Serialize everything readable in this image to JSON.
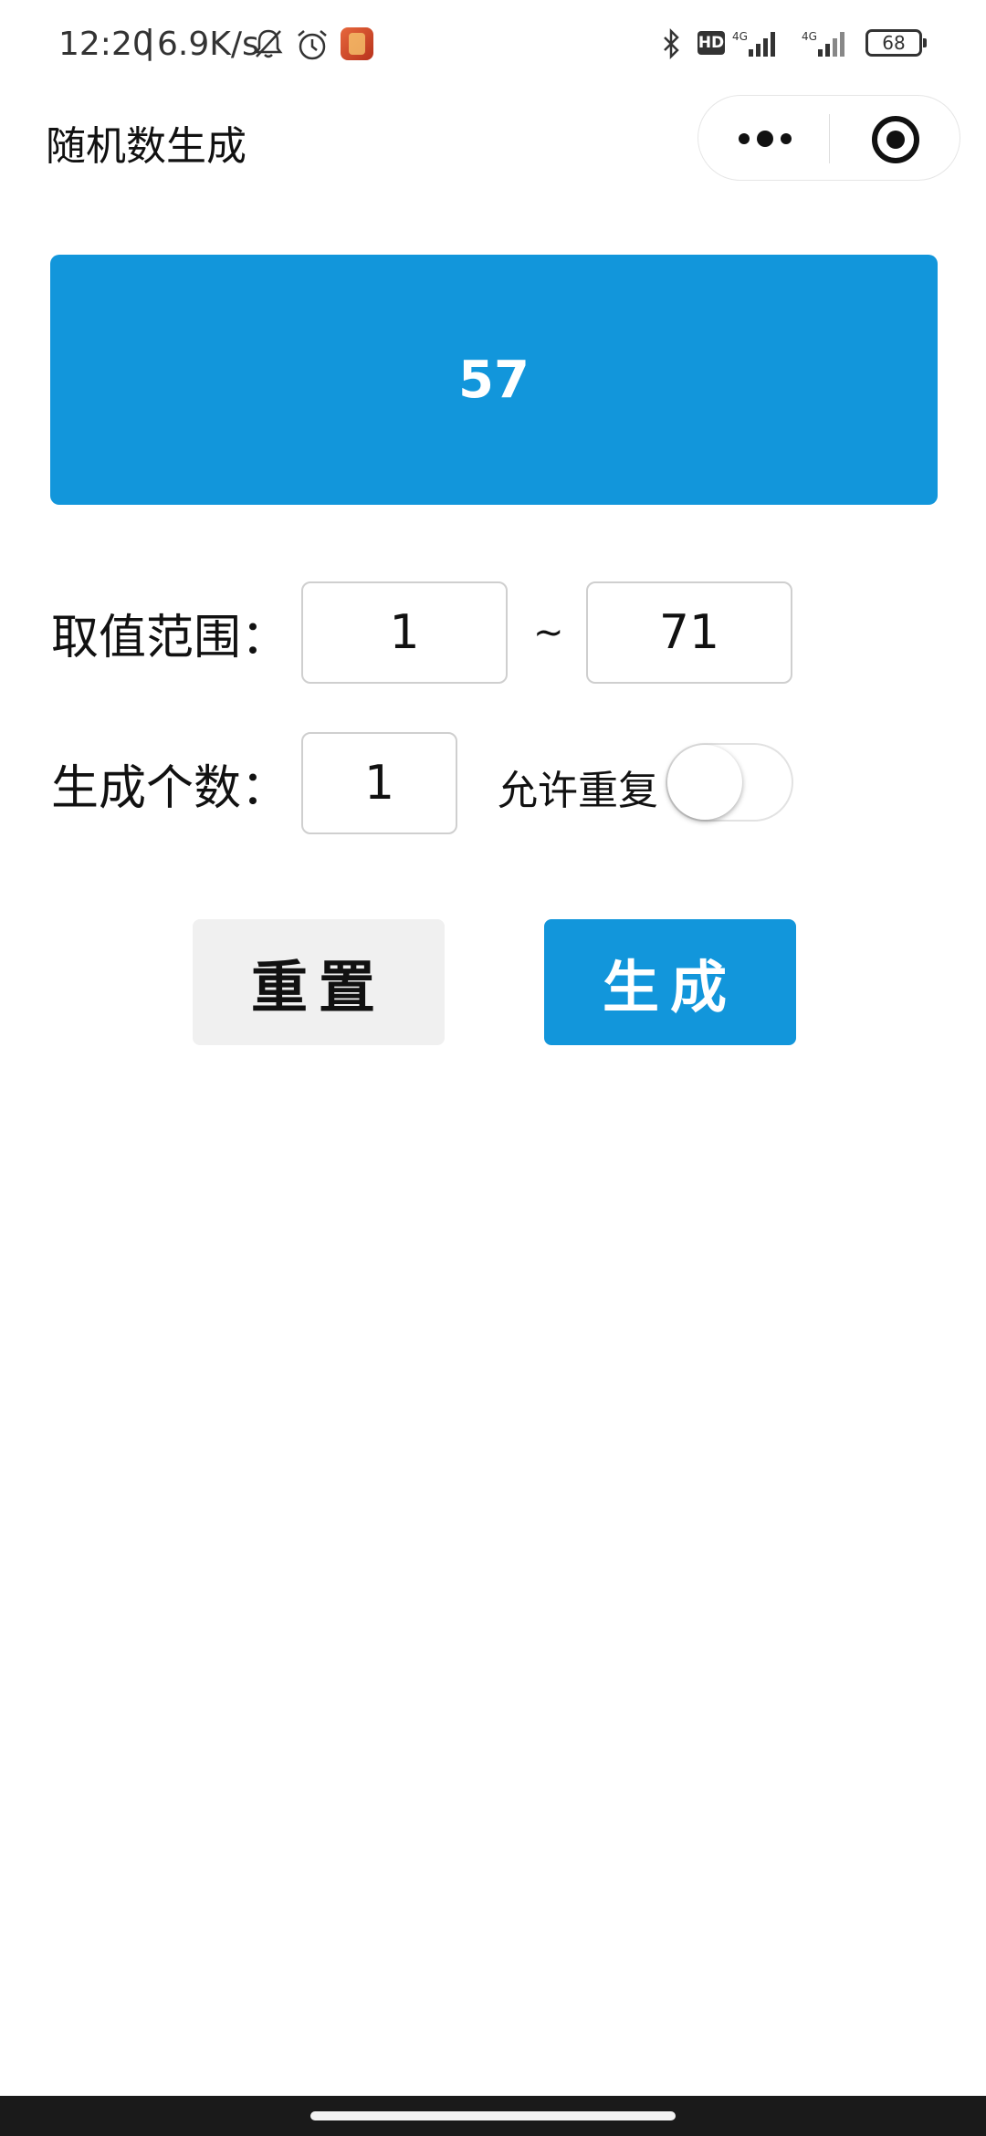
{
  "status_bar": {
    "time": "12:20",
    "separator": "|",
    "net_speed": "6.9K/s",
    "hd_badge": "HD",
    "battery": "68",
    "icons": [
      "bell-off-icon",
      "alarm-icon",
      "app-icon",
      "bluetooth-icon",
      "signal-4g-icon",
      "signal-4g-icon"
    ]
  },
  "nav": {
    "title": "随机数生成",
    "capsule_icons": [
      "more-icon",
      "target-icon"
    ]
  },
  "result": {
    "value": "57"
  },
  "range": {
    "label": "取值范围：",
    "min": "1",
    "separator": "~",
    "max": "71"
  },
  "count": {
    "label": "生成个数：",
    "value": "1",
    "allow_repeat_label": "允许重复",
    "allow_repeat": false
  },
  "buttons": {
    "reset": "重置",
    "generate": "生成"
  },
  "colors": {
    "accent": "#1296db",
    "reset_bg": "#f0f0f0"
  }
}
